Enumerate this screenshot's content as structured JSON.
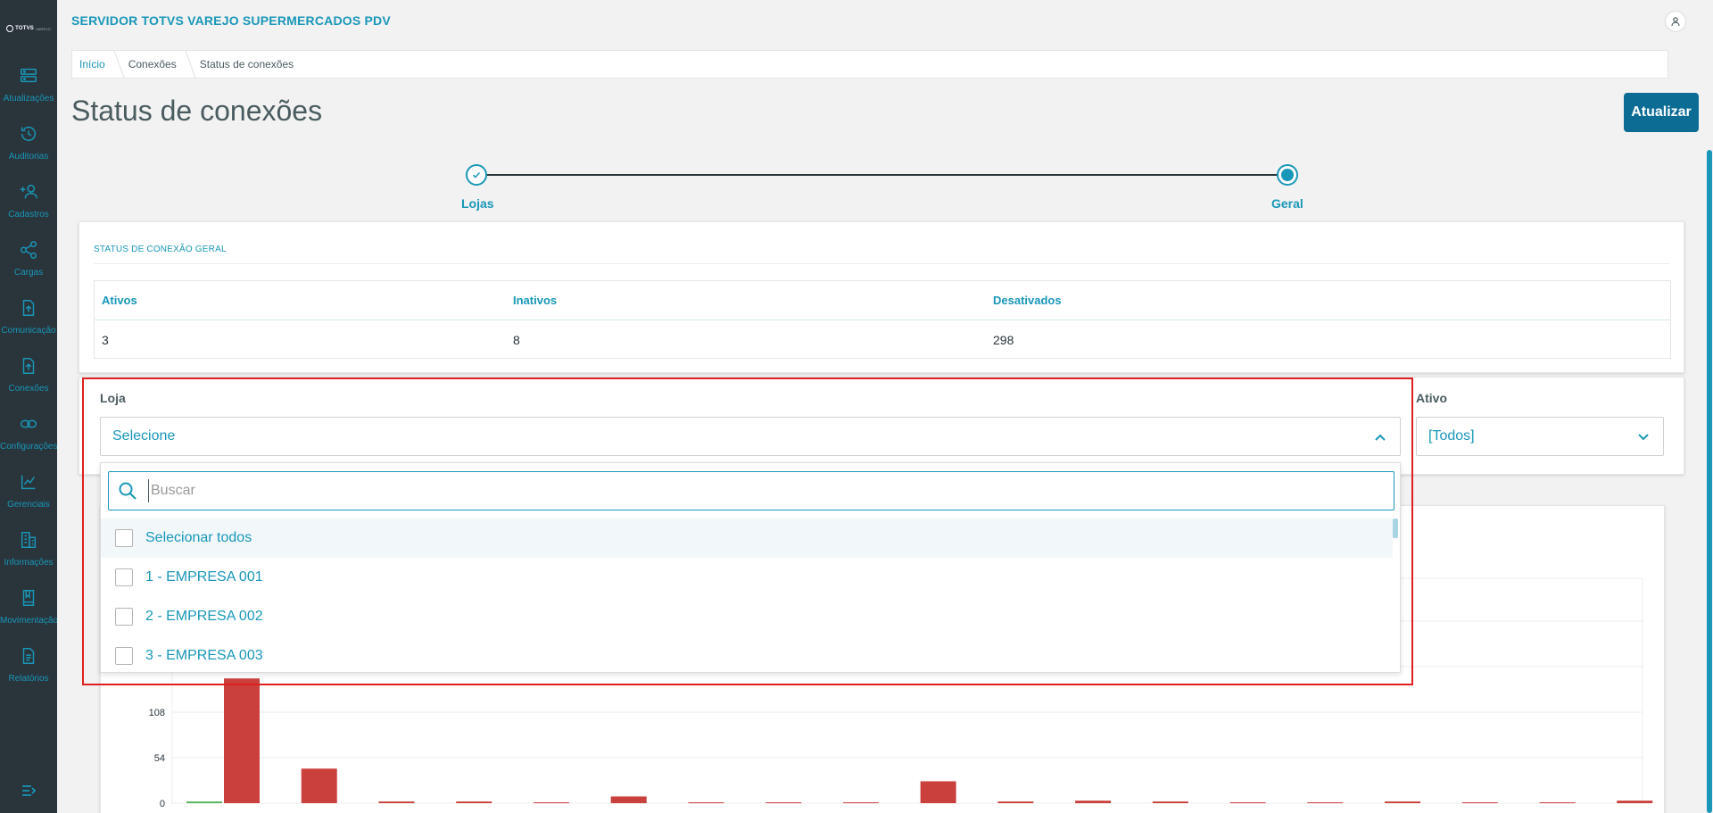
{
  "app": {
    "title": "SERVIDOR TOTVS VAREJO SUPERMERCADOS PDV",
    "logo_text": "TOTVS",
    "logo_sub": "VAREJO"
  },
  "sidebar": {
    "items": [
      {
        "label": "Atualizações",
        "icon": "server-icon"
      },
      {
        "label": "Auditorias",
        "icon": "history-icon"
      },
      {
        "label": "Cadastros",
        "icon": "add-user-icon"
      },
      {
        "label": "Cargas",
        "icon": "share-icon"
      },
      {
        "label": "Comunicação",
        "icon": "file-upload-icon"
      },
      {
        "label": "Conexões",
        "icon": "file-upload-icon"
      },
      {
        "label": "Configurações",
        "icon": "link-icon"
      },
      {
        "label": "Gerenciais",
        "icon": "chart-icon"
      },
      {
        "label": "Informações",
        "icon": "building-icon"
      },
      {
        "label": "Movimentação",
        "icon": "book-icon"
      },
      {
        "label": "Relatórios",
        "icon": "document-icon"
      }
    ]
  },
  "breadcrumb": [
    "Início",
    "Conexões",
    "Status de conexões"
  ],
  "page": {
    "title": "Status de conexões",
    "refresh_label": "Atualizar"
  },
  "stepper": {
    "steps": [
      "Lojas",
      "Geral"
    ],
    "active": 1
  },
  "status": {
    "title": "STATUS DE CONEXÃO GERAL",
    "headers": [
      "Ativos",
      "Inativos",
      "Desativados"
    ],
    "values": [
      "3",
      "8",
      "298"
    ]
  },
  "filters": {
    "loja": {
      "label": "Loja",
      "value": "Selecione"
    },
    "ativo": {
      "label": "Ativo",
      "value": "[Todos]"
    }
  },
  "dropdown": {
    "search_placeholder": "Buscar",
    "options": [
      "Selecionar todos",
      "1 - EMPRESA 001",
      "2 - EMPRESA 002",
      "3 - EMPRESA 003"
    ]
  },
  "colors": {
    "accent": "#1997b8",
    "primary_button": "#0c6c94",
    "sidebar": "#29343b",
    "bar_inactive": "#c9403d",
    "bar_active": "#59b35c"
  },
  "chart_data": {
    "type": "bar",
    "yticks": [
      0,
      54,
      108
    ],
    "ylim": [
      0,
      162
    ],
    "series": [
      {
        "values": [
          2,
          0,
          0,
          0,
          0,
          0,
          0,
          0,
          0,
          0,
          0,
          0,
          0,
          0,
          0,
          0,
          0,
          0,
          0
        ]
      },
      {
        "values": [
          148,
          41,
          2,
          2,
          1,
          8,
          1,
          1,
          1,
          26,
          2,
          3,
          2,
          1,
          1,
          2,
          1,
          1,
          3
        ]
      }
    ]
  }
}
